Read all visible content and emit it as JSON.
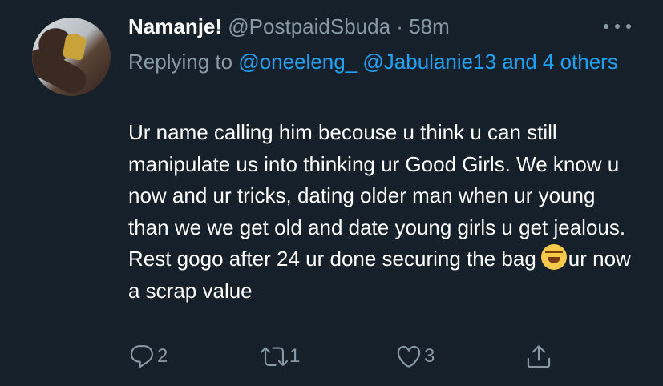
{
  "tweet": {
    "display_name": "Namanje!",
    "handle": "@PostpaidSbuda",
    "separator": "·",
    "time": "58m",
    "reply": {
      "prefix": "Replying to",
      "mentions": [
        "@oneeleng_",
        "@Jabulanie13"
      ],
      "and_others": "and 4 others"
    },
    "text_before_emoji": "Ur name calling him becouse u think u can still manipulate us into thinking ur Good Girls. We know u now and ur tricks, dating older man when ur young than we we get old and date young girls u get jealous. Rest gogo after 24 ur done securing the bag",
    "text_after_emoji": "ur now a scrap value",
    "emoji": "rolling-on-floor-laughing",
    "actions": {
      "replies": "2",
      "retweets": "1",
      "likes": "3"
    }
  },
  "colors": {
    "background": "#15202b",
    "text": "#ffffff",
    "muted": "#8899a6",
    "link": "#1da1f2"
  }
}
